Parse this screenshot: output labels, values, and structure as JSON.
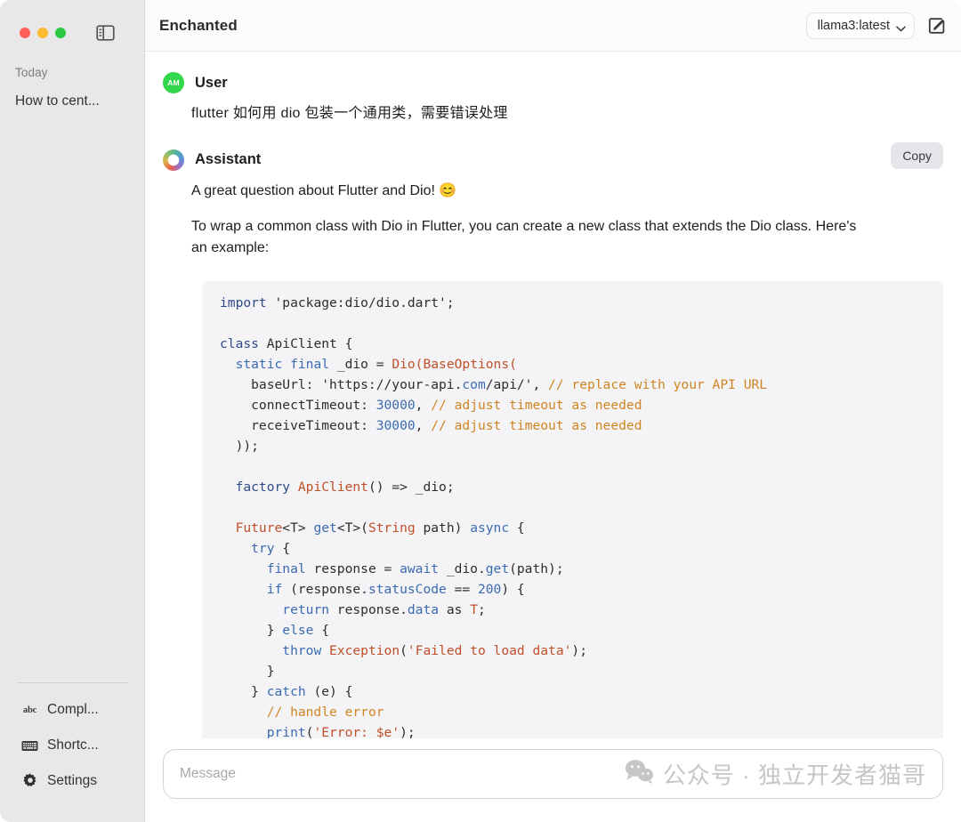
{
  "window": {
    "traffic_lights": [
      "close",
      "minimize",
      "maximize"
    ],
    "colors": {
      "close": "#ff5f57",
      "minimize": "#febc2e",
      "maximize": "#28c840",
      "sidebar_bg": "#e8e8e8",
      "code_bg": "#f4f4f7",
      "accent_user_avatar": "#32d74b",
      "copy_button_bg": "#e5e5ea"
    }
  },
  "sidebar": {
    "toggle_icon": "sidebar-toggle-icon",
    "section_label": "Today",
    "chats": [
      {
        "title": "How to cent..."
      }
    ],
    "bottom_items": [
      {
        "icon": "abc-spellcheck-icon",
        "label": "Compl..."
      },
      {
        "icon": "keyboard-icon",
        "label": "Shortc..."
      },
      {
        "icon": "gear-icon",
        "label": "Settings"
      }
    ]
  },
  "header": {
    "title": "Enchanted",
    "model_selector": {
      "value": "llama3:latest",
      "chevron": "chevron-down-icon"
    },
    "compose_icon": "compose-new-chat-icon"
  },
  "conversation": {
    "messages": [
      {
        "role": "User",
        "avatar_initials": "AM",
        "avatar_type": "user",
        "text": "flutter 如何用 dio 包装一个通用类，需要错误处理"
      },
      {
        "role": "Assistant",
        "avatar_type": "assistant",
        "copy_label": "Copy",
        "paragraphs": [
          "A great question about Flutter and Dio! 😊",
          "To wrap a common class with Dio in Flutter, you can create a new class that extends the Dio class. Here's an example:"
        ],
        "code": {
          "language": "dart",
          "lines": [
            "import 'package:dio/dio.dart';",
            "",
            "class ApiClient {",
            "  static final _dio = Dio(BaseOptions(",
            "    baseUrl: 'https://your-api.com/api/', // replace with your API URL",
            "    connectTimeout: 30000, // adjust timeout as needed",
            "    receiveTimeout: 30000, // adjust timeout as needed",
            "  ));",
            "",
            "  factory ApiClient() => _dio;",
            "",
            "  Future<T> get<T>(String path) async {",
            "    try {",
            "      final response = await _dio.get(path);",
            "      if (response.statusCode == 200) {",
            "        return response.data as T;",
            "      } else {",
            "        throw Exception('Failed to load data');",
            "      }",
            "    } catch (e) {",
            "      // handle error",
            "      print('Error: $e');"
          ]
        }
      }
    ]
  },
  "composer": {
    "placeholder": "Message",
    "value": "",
    "watermark": {
      "icon": "wechat-chat-bubbles-icon",
      "text": "公众号 · 独立开发者猫哥"
    }
  }
}
